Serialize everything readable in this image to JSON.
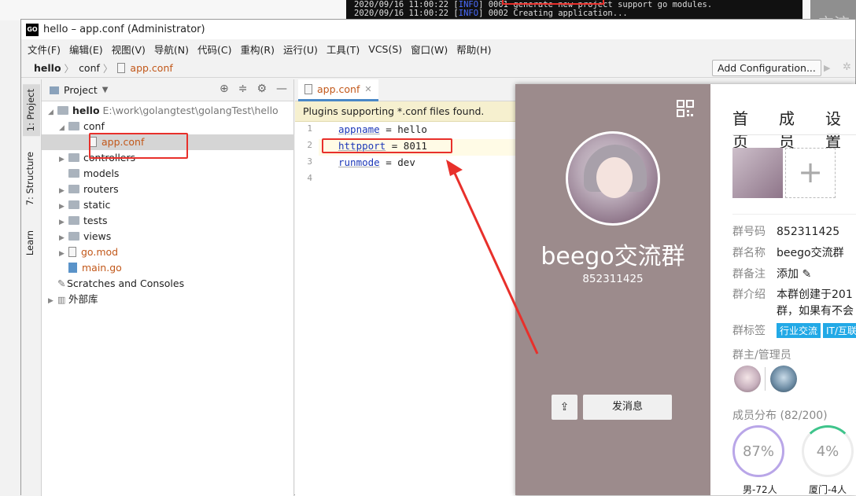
{
  "background": {
    "terminal_lines": [
      {
        "time": "2020/09/16 11:00:22",
        "level": "INFO",
        "msg": "0001 generate new project support go modules."
      },
      {
        "time": "2020/09/16 11:00:22",
        "level": "INFO",
        "msg": "0002 Creating application..."
      }
    ],
    "right_text": "交流"
  },
  "window": {
    "title": "hello – app.conf (Administrator)",
    "logo_text": "GO"
  },
  "menu": [
    "文件(F)",
    "编辑(E)",
    "视图(V)",
    "导航(N)",
    "代码(C)",
    "重构(R)",
    "运行(U)",
    "工具(T)",
    "VCS(S)",
    "窗口(W)",
    "帮助(H)"
  ],
  "navbar": {
    "crumbs": [
      "hello",
      "conf",
      "app.conf"
    ],
    "add_config": "Add Configuration..."
  },
  "side_tabs": [
    "1: Project",
    "7: Structure",
    "Learn"
  ],
  "project": {
    "header": "Project",
    "root_name": "hello",
    "root_path": "E:\\work\\golangtest\\golangTest\\hello",
    "items": [
      {
        "label": "conf",
        "type": "folder"
      },
      {
        "label": "app.conf",
        "type": "file"
      },
      {
        "label": "controllers",
        "type": "folder"
      },
      {
        "label": "models",
        "type": "folder"
      },
      {
        "label": "routers",
        "type": "folder"
      },
      {
        "label": "static",
        "type": "folder"
      },
      {
        "label": "tests",
        "type": "folder"
      },
      {
        "label": "views",
        "type": "folder"
      },
      {
        "label": "go.mod",
        "type": "file"
      },
      {
        "label": "main.go",
        "type": "gofile"
      },
      {
        "label": "Scratches and Consoles",
        "type": "misc"
      },
      {
        "label": "外部库",
        "type": "lib"
      }
    ]
  },
  "editor": {
    "tab": "app.conf",
    "notice": "Plugins supporting *.conf files found.",
    "lines": [
      {
        "n": "1",
        "key": "appname",
        "rest": " = hello"
      },
      {
        "n": "2",
        "key": "httpport",
        "rest": " = 8011"
      },
      {
        "n": "3",
        "key": "runmode",
        "rest": " = dev"
      },
      {
        "n": "4",
        "key": "",
        "rest": ""
      }
    ]
  },
  "qq_card": {
    "group_name": "beego交流群",
    "group_number": "852311425",
    "send_button": "发消息",
    "tabs": [
      "首页",
      "成员",
      "设置"
    ],
    "info": {
      "number_label": "群号码",
      "number_value": "852311425",
      "name_label": "群名称",
      "name_value": "beego交流群",
      "remark_label": "群备注",
      "remark_value": "添加",
      "intro_label": "群介绍",
      "intro_line1": "本群创建于201",
      "intro_line2": "群，如果有不会",
      "tags_label": "群标签",
      "tag1": "行业交流",
      "tag2": "IT/互联"
    },
    "admins_title": "群主/管理员",
    "distribution_title": "成员分布 (82/200)",
    "stats": [
      {
        "value": "87%",
        "label": "男-72人"
      },
      {
        "value": "4%",
        "label": "厦门-4人"
      }
    ],
    "colors": {
      "left_panel": "#9c8b8c",
      "tag": "#22a9e6",
      "male_ring": "#b9a6e8",
      "city_ring": "#3fc48b"
    }
  }
}
